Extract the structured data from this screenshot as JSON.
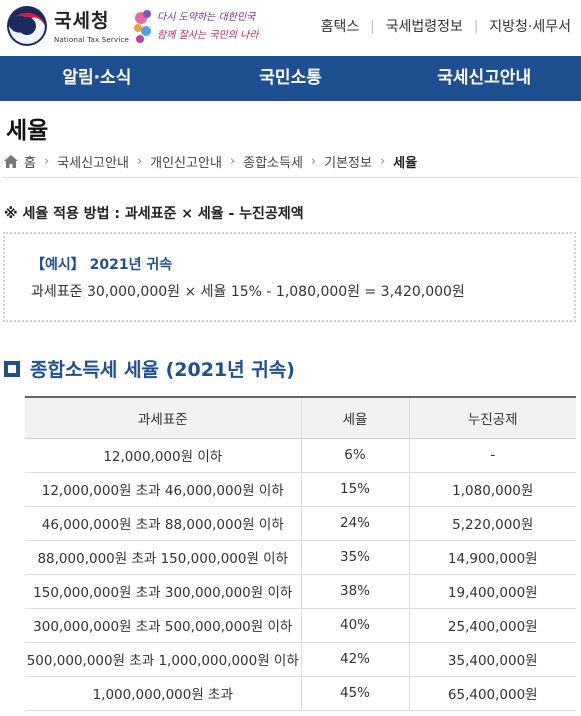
{
  "header": {
    "logo_text": "국세청",
    "logo_sub": "National Tax Service",
    "slogan_line1": "다시 도약하는 대한민국",
    "slogan_line2": "함께 잘사는 국민의 나라",
    "links": [
      "홈택스",
      "국세법령정보",
      "지방청·세무서"
    ]
  },
  "nav": [
    "알림·소식",
    "국민소통",
    "국세신고안내"
  ],
  "page_title": "세율",
  "breadcrumb": [
    "홈",
    "국세신고안내",
    "개인신고안내",
    "종합소득세",
    "기본정보",
    "세율"
  ],
  "formula": "※ 세율 적용 방법 : 과세표준 × 세율 - 누진공제액",
  "example": {
    "title": "【예시】 2021년 귀속",
    "body": "과세표준 30,000,000원 × 세율 15% - 1,080,000원 = 3,420,000원"
  },
  "section_title": "종합소득세 세율 (2021년 귀속)",
  "table": {
    "headers": [
      "과세표준",
      "세율",
      "누진공제"
    ],
    "rows": [
      [
        "12,000,000원 이하",
        "6%",
        "-"
      ],
      [
        "12,000,000원 초과 46,000,000원 이하",
        "15%",
        "1,080,000원"
      ],
      [
        "46,000,000원 초과 88,000,000원 이하",
        "24%",
        "5,220,000원"
      ],
      [
        "88,000,000원 초과 150,000,000원 이하",
        "35%",
        "14,900,000원"
      ],
      [
        "150,000,000원 초과 300,000,000원 이하",
        "38%",
        "19,400,000원"
      ],
      [
        "300,000,000원 초과 500,000,000원 이하",
        "40%",
        "25,400,000원"
      ],
      [
        "500,000,000원 초과 1,000,000,000원 이하",
        "42%",
        "35,400,000원"
      ],
      [
        "1,000,000,000원 초과",
        "45%",
        "65,400,000원"
      ]
    ]
  },
  "colors": {
    "brand": "#1d4f91",
    "nav_bg": "#1d4f91"
  }
}
